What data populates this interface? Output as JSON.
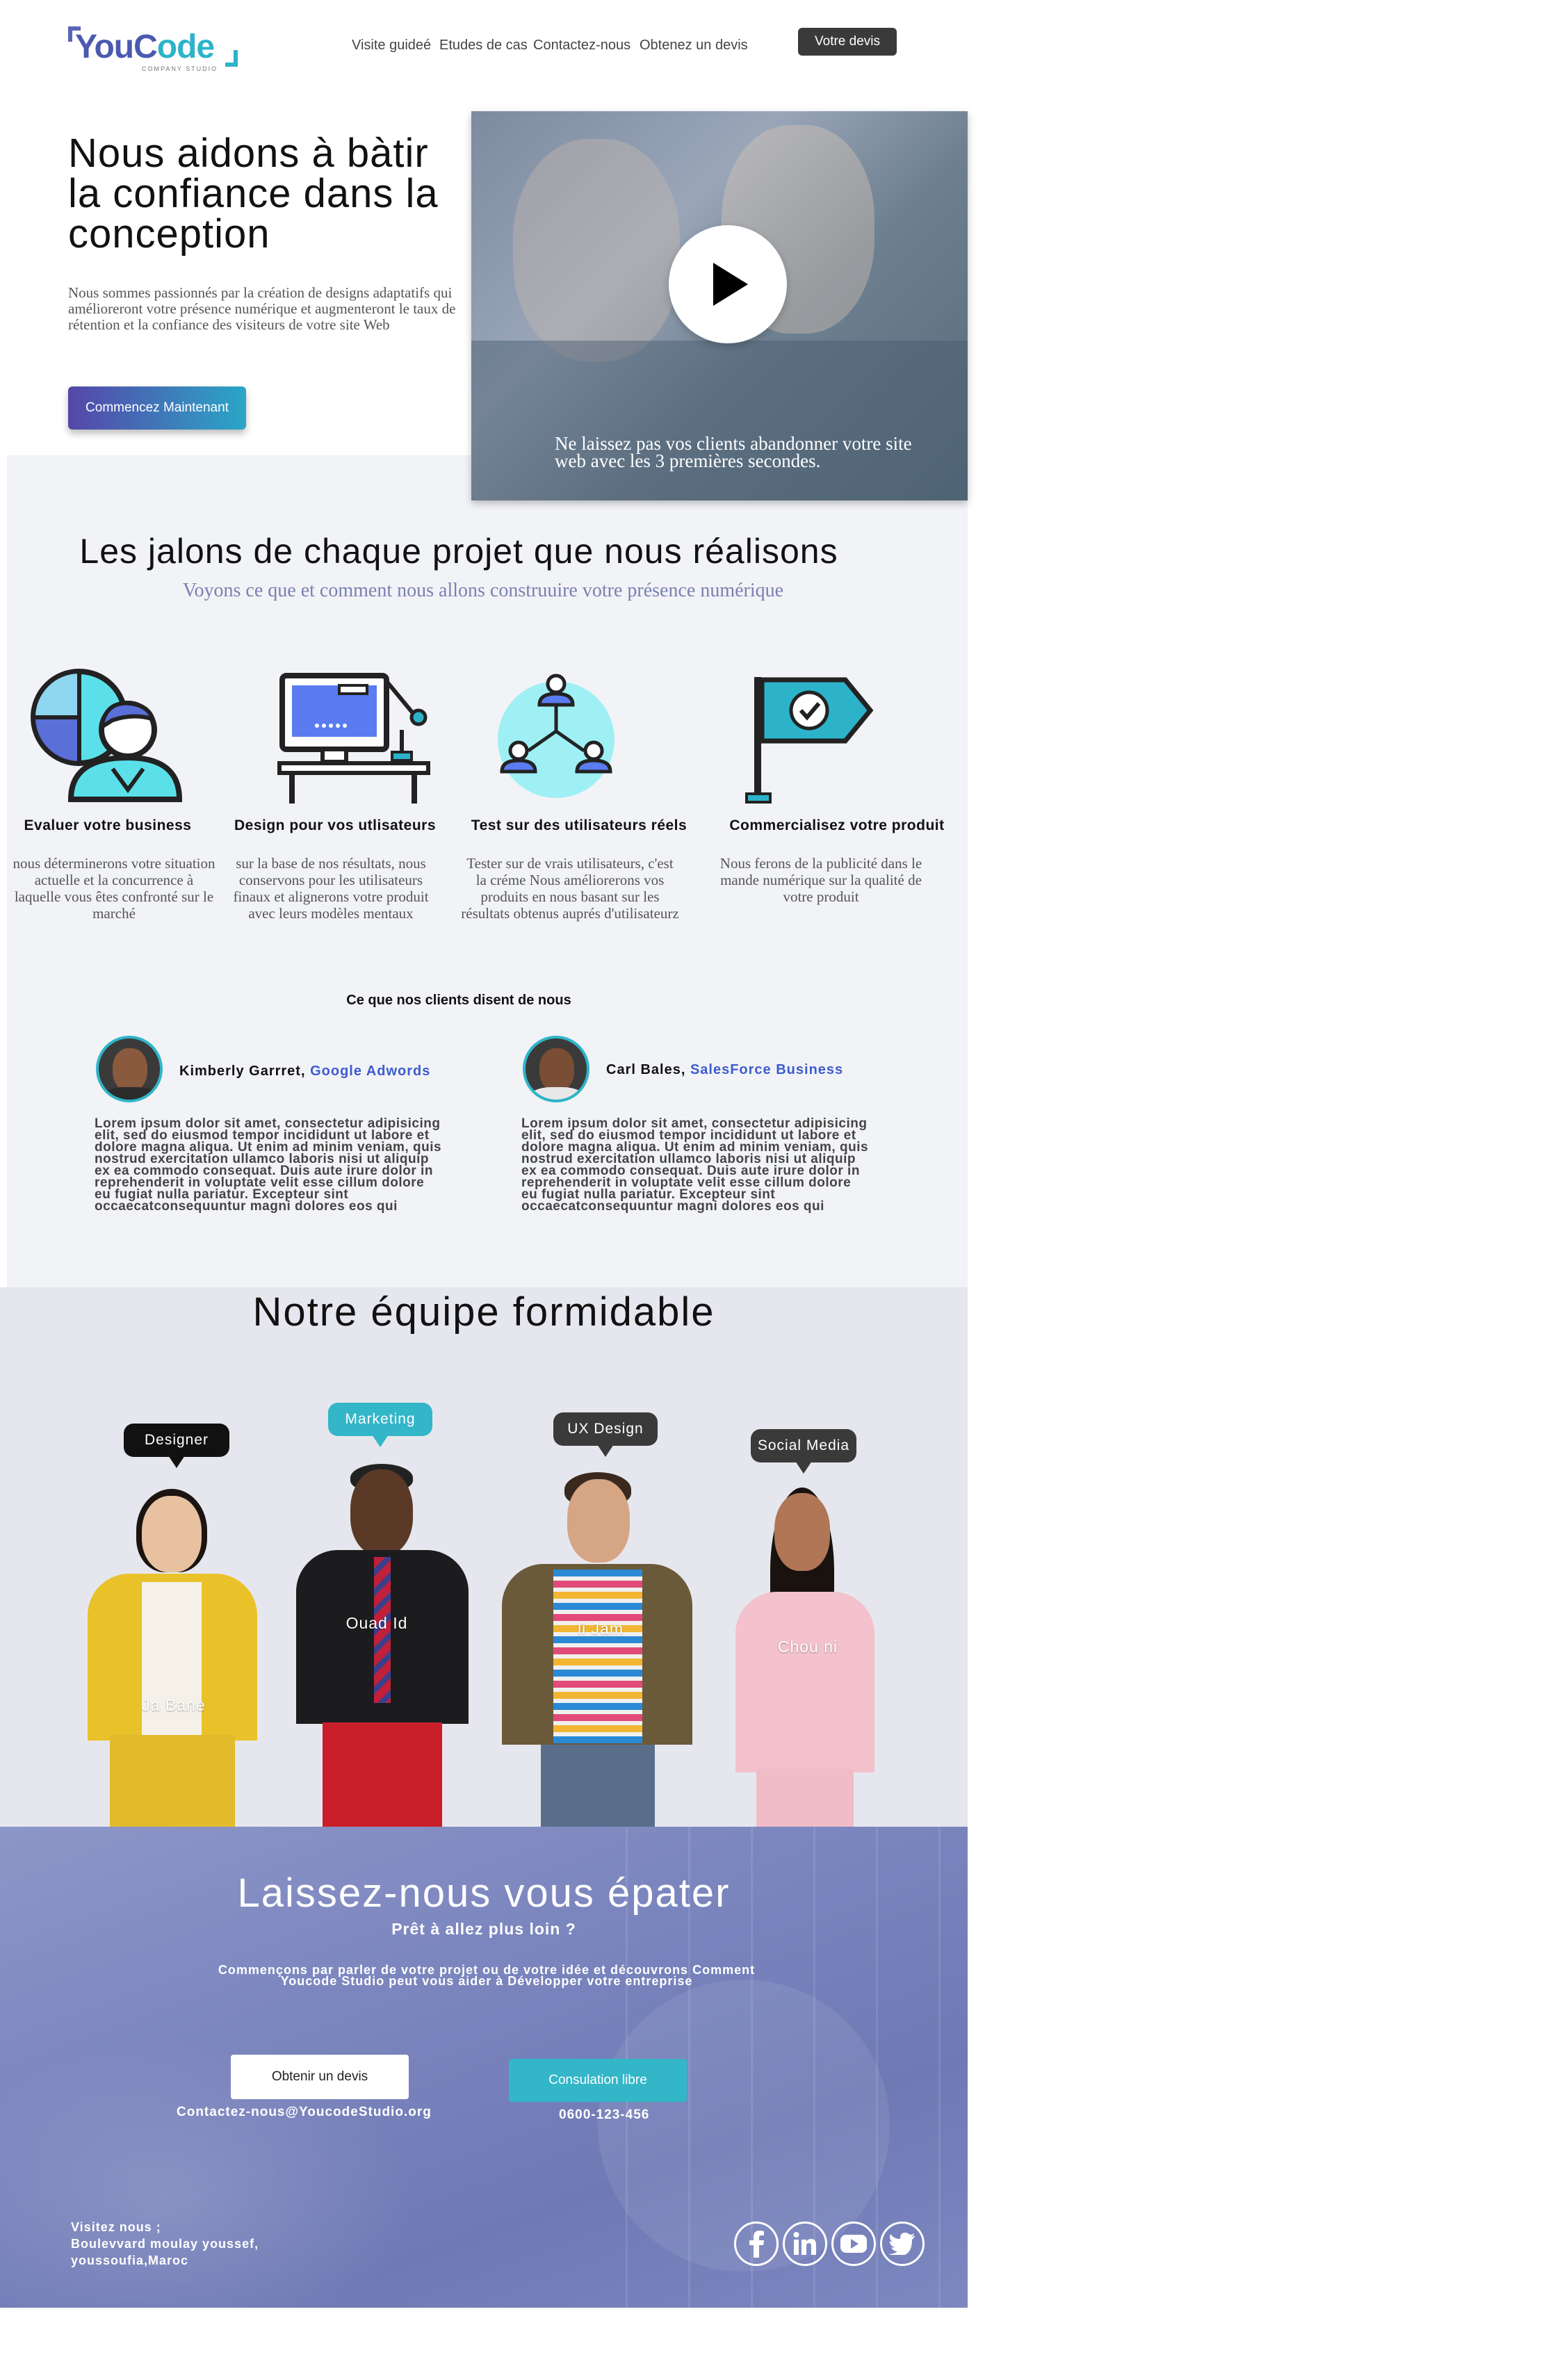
{
  "header": {
    "logo_text_a": "YouC",
    "logo_text_b": "ode",
    "logo_tagline": "COMPANY STUDIO",
    "nav": [
      "Visite guideé",
      "Etudes de cas",
      "Contactez-nous",
      "Obtenez un devis"
    ],
    "quote_button": "Votre devis"
  },
  "hero": {
    "title": "Nous aidons à bàtir la confiance dans la conception",
    "description": "Nous sommes passionnés par la création de designs adaptatifs qui amélioreront votre présence numérique et augmenteront le taux de rétention et la confiance des visiteurs de votre site Web",
    "cta_button": "Commencez Maintenant",
    "video_caption": "Ne laissez pas vos clients abandonner votre site web avec les 3 premières secondes."
  },
  "milestones": {
    "title": "Les jalons de chaque projet que nous réalisons",
    "subtitle": "Voyons ce que et comment nous allons construuire votre présence numérique",
    "steps": [
      {
        "icon": "business-analysis-icon",
        "title": "Evaluer votre business",
        "desc": "nous déterminerons votre situation actuelle et la concurrence à laquelle vous êtes confronté sur le marché"
      },
      {
        "icon": "design-workstation-icon",
        "title": "Design pour vos utlisateurs",
        "desc": "sur la base de nos résultats, nous conservons pour les utilisateurs finaux et alignerons votre produit avec leurs modèles mentaux"
      },
      {
        "icon": "user-network-icon",
        "title": "Test sur des utilisateurs réels",
        "desc": "Tester sur de vrais utilisateurs, c'est la créme Nous améliorerons vos produits en nous basant sur les résultats obtenus auprés d'utilisateurz"
      },
      {
        "icon": "flag-check-icon",
        "title": "Commercialisez votre produit",
        "desc": "Nous ferons de la publicité dans le mande numérique sur la qualité de votre produit"
      }
    ]
  },
  "testimonials": {
    "heading": "Ce que nos clients disent de nous",
    "items": [
      {
        "name": "Kimberly Garrret,",
        "company": "Google Adwords",
        "text": "Lorem ipsum dolor sit amet, consectetur adipisicing elit, sed do eiusmod tempor incididunt ut labore et dolore magna aliqua. Ut enim ad minim veniam, quis nostrud exercitation ullamco laboris nisi ut aliquip ex ea commodo consequat. Duis aute irure dolor in reprehenderit in voluptate velit esse cillum dolore eu fugiat nulla pariatur. Excepteur sint occaecatconsequuntur magni dolores eos qui"
      },
      {
        "name": "Carl Bales,",
        "company": "SalesForce Business",
        "text": "Lorem ipsum dolor sit amet, consectetur adipisicing elit, sed do eiusmod tempor incididunt ut labore et dolore magna aliqua. Ut enim ad minim veniam, quis nostrud exercitation ullamco laboris nisi ut aliquip ex ea commodo consequat. Duis aute irure dolor in reprehenderit in voluptate velit esse cillum dolore eu fugiat nulla pariatur. Excepteur sint occaecatconsequuntur magni dolores eos qui"
      }
    ]
  },
  "team": {
    "title": "Notre équipe formidable",
    "members": [
      {
        "role": "Designer",
        "name": "Ja Bane",
        "bubble_color": "#111111"
      },
      {
        "role": "Marketing",
        "name": "Ouad Id",
        "bubble_color": "#32b6c8"
      },
      {
        "role": "UX Design",
        "name": "li Jam",
        "bubble_color": "#3a3a3a"
      },
      {
        "role": "Social Media",
        "name": "Chou ni",
        "bubble_color": "#3a3a3a"
      }
    ]
  },
  "cta": {
    "title": "Laissez-nous vous épater",
    "subtitle": "Prêt à allez plus loin ?",
    "text": "Commençons par parler de votre projet ou de votre idée et découvrons Comment Youcode Studio peut vous aider à Développer votre entreprise",
    "quote_button": "Obtenir un devis",
    "consult_button": "Consulation libre",
    "email": "Contactez-nous@YoucodeStudio.org",
    "phone": "0600-123-456",
    "address_lines": [
      "Visitez nous ;",
      "Boulevvard moulay  youssef,",
      "youssoufia,Maroc"
    ],
    "social": [
      "facebook-icon",
      "linkedin-icon",
      "youtube-icon",
      "twitter-icon"
    ]
  },
  "colors": {
    "brand_blue": "#4b5ab0",
    "accent_teal": "#32b6c8",
    "cta_bg": "#7a84bd"
  }
}
